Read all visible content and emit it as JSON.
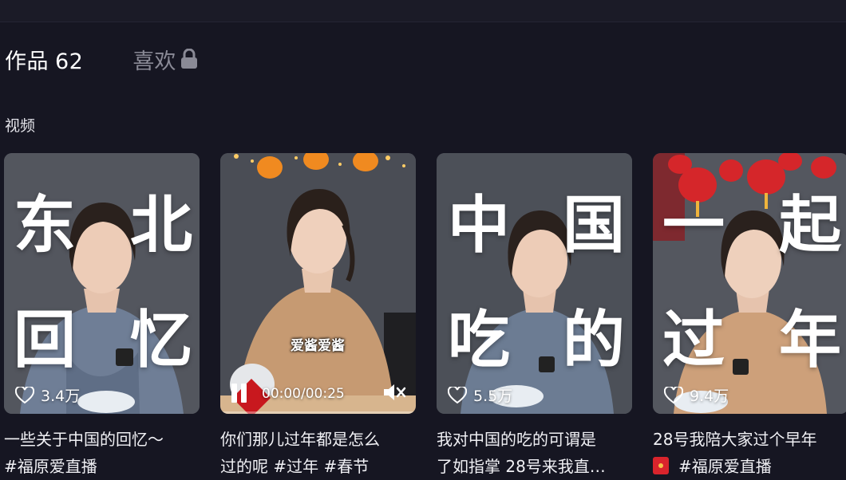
{
  "tabs": {
    "works_label": "作品",
    "works_count": "62",
    "likes_label": "喜欢"
  },
  "section_title": "视频",
  "player": {
    "time": "00:00/00:25",
    "subtitle": "爱酱爱酱"
  },
  "videos": [
    {
      "overlay_title": [
        "东",
        "北",
        "回",
        "忆"
      ],
      "likes": "3.4万",
      "caption_line1": "一些关于中国的回忆～",
      "caption_line2": "#福原爱直播"
    },
    {
      "likes": "",
      "caption_line1": "你们那儿过年都是怎么",
      "caption_line2": "过的呢 #过年 #春节"
    },
    {
      "overlay_title": [
        "中",
        "国",
        "吃",
        "的"
      ],
      "likes": "5.5万",
      "caption_line1": "我对中国的吃的可谓是",
      "caption_line2": "了如指掌 28号来我直…"
    },
    {
      "overlay_title": [
        "一",
        "起",
        "过",
        "年"
      ],
      "likes": "9.4万",
      "caption_line1": "28号我陪大家过个早年",
      "caption_line2": "#福原爱直播"
    }
  ],
  "icons": [
    "lock-icon",
    "heart-icon",
    "pause-icon",
    "mute-icon",
    "lantern-icon",
    "red-envelope-icon"
  ]
}
